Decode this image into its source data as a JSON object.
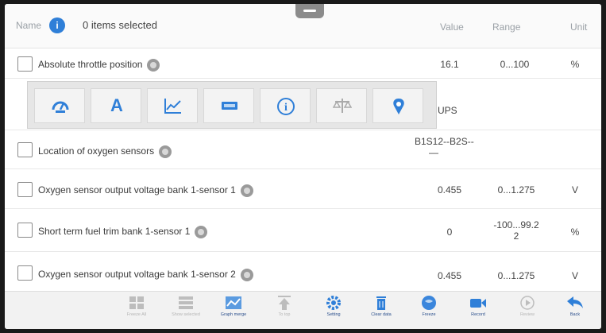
{
  "header": {
    "name_label": "Name",
    "info_glyph": "i",
    "selected_text": "0 items selected",
    "col_value": "Value",
    "col_range": "Range",
    "col_unit": "Unit"
  },
  "rows": [
    {
      "label": "Absolute throttle position",
      "value": "16.1",
      "range": "0...100",
      "unit": "%"
    },
    {
      "label": "",
      "value": "UPS",
      "range": "",
      "unit": ""
    },
    {
      "label": "Location of oxygen sensors",
      "value": "B1S12--B2S--",
      "value_line2": "—",
      "range": "",
      "unit": ""
    },
    {
      "label": "Oxygen sensor output voltage bank 1-sensor 1",
      "value": "0.455",
      "range": "0...1.275",
      "unit": "V"
    },
    {
      "label": "Short term fuel trim bank 1-sensor 1",
      "value": "0",
      "range": "-100...99.2",
      "range_line2": "2",
      "unit": "%"
    },
    {
      "label": "Oxygen sensor output voltage bank 1-sensor 2",
      "value": "0.455",
      "range": "0...1.275",
      "unit": "V"
    }
  ],
  "popup_tools": [
    {
      "icon": "gauge-icon"
    },
    {
      "icon": "text-mode-icon",
      "glyph": "A"
    },
    {
      "icon": "line-graph-icon"
    },
    {
      "icon": "digital-display-icon"
    },
    {
      "icon": "info-icon",
      "glyph": "i"
    },
    {
      "icon": "scale-icon"
    },
    {
      "icon": "location-pin-icon"
    }
  ],
  "bottom_bar": [
    {
      "label": "Freeze All",
      "icon": "grid-icon",
      "enabled": false
    },
    {
      "label": "Show selected",
      "icon": "list-icon",
      "enabled": false
    },
    {
      "label": "Graph merge",
      "icon": "graph-merge-icon",
      "enabled": true
    },
    {
      "label": "To top",
      "icon": "to-top-icon",
      "enabled": false
    },
    {
      "label": "Setting",
      "icon": "setting-icon",
      "enabled": true
    },
    {
      "label": "Clear data",
      "icon": "clear-data-icon",
      "enabled": true
    },
    {
      "label": "Freeze",
      "icon": "freeze-icon",
      "enabled": true
    },
    {
      "label": "Record",
      "icon": "record-icon",
      "enabled": true
    },
    {
      "label": "Review",
      "icon": "review-icon",
      "enabled": false
    },
    {
      "label": "Back",
      "icon": "back-icon",
      "enabled": true
    }
  ],
  "colors": {
    "accent": "#2f7fd8",
    "disabled": "#b5b5b5"
  }
}
